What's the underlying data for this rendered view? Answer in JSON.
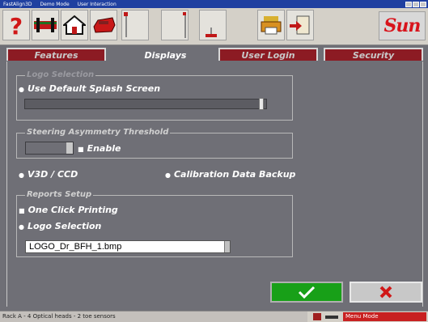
{
  "window": {
    "title_parts": [
      "FastAlign3D",
      "Demo Mode",
      "User Interaction"
    ]
  },
  "tabs": [
    {
      "label": "Features",
      "active": false
    },
    {
      "label": "Displays",
      "active": true
    },
    {
      "label": "User Login",
      "active": false
    },
    {
      "label": "Security",
      "active": false
    }
  ],
  "toolbar": {
    "logo_text": "Sun",
    "icons": [
      "help-icon",
      "vehicle-alignment-icon",
      "home-icon",
      "vehicle-icon",
      "marker-icon",
      "marker-icon",
      "marker-icon",
      "printer-icon",
      "document-arrow-icon"
    ]
  },
  "displays": {
    "splash_group_title": "Logo Selection",
    "use_default_splash": "Use Default Splash Screen",
    "splash_slider_level": 0.99,
    "steering_group_title": "Steering Asymmetry Threshold",
    "enable_label": "Enable",
    "v3d_ccd_label": "V3D / CCD",
    "calibration_backup_label": "Calibration Data Backup",
    "reports_group_title": "Reports Setup",
    "one_click_printing": "One Click Printing",
    "logo_selection": "Logo Selection",
    "logo_file": "LOGO_Dr_BFH_1.bmp"
  },
  "buttons": {
    "ok": "ok",
    "cancel": "cancel"
  },
  "status": {
    "left_text": "Rack A - 4 Optical heads - 2 toe sensors",
    "right_text": "Menu Mode"
  },
  "colors": {
    "tab_inactive": "#8c1b23",
    "background": "#6f6f76",
    "ok_button": "#18a018",
    "cancel_x": "#d01818",
    "status_red": "#c82020",
    "logo_red": "#d8141c"
  }
}
